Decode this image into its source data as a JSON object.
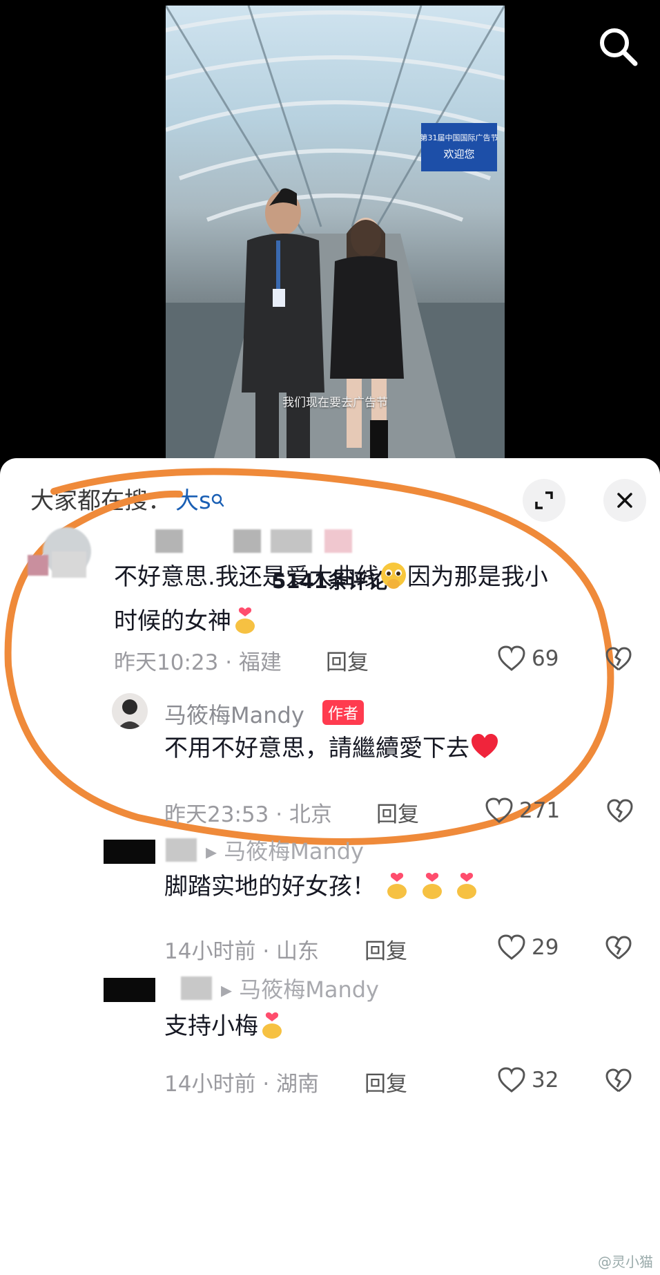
{
  "video": {
    "subtitle": "我们现在要去广告节",
    "banner_line1": "第31届中国国际广告节",
    "banner_line2": "欢迎您"
  },
  "sheet": {
    "search_prefix": "大家都在搜：",
    "search_keyword": "大s",
    "comment_count_title": "5141条评论"
  },
  "comments": [
    {
      "text_line1": "不好意思.我还是爱大曲线",
      "text_line1b": "因为那是我小",
      "text_line2": "时候的女神",
      "time": "昨天10:23",
      "location": "福建",
      "reply_label": "回复",
      "likes": "69"
    },
    {
      "username": "马筱梅Mandy",
      "author_tag": "作者",
      "text": "不用不好意思，請繼續愛下去",
      "time": "昨天23:53",
      "location": "北京",
      "reply_label": "回复",
      "likes": "271"
    },
    {
      "reply_to": "马筱梅Mandy",
      "text": "脚踏实地的好女孩！",
      "time": "14小时前",
      "location": "山东",
      "reply_label": "回复",
      "likes": "29"
    },
    {
      "reply_to": "马筱梅Mandy",
      "text": "支持小梅",
      "time": "14小时前",
      "location": "湖南",
      "reply_label": "回复",
      "likes": "32"
    }
  ],
  "separator": "·",
  "watermark": "@灵小猫"
}
